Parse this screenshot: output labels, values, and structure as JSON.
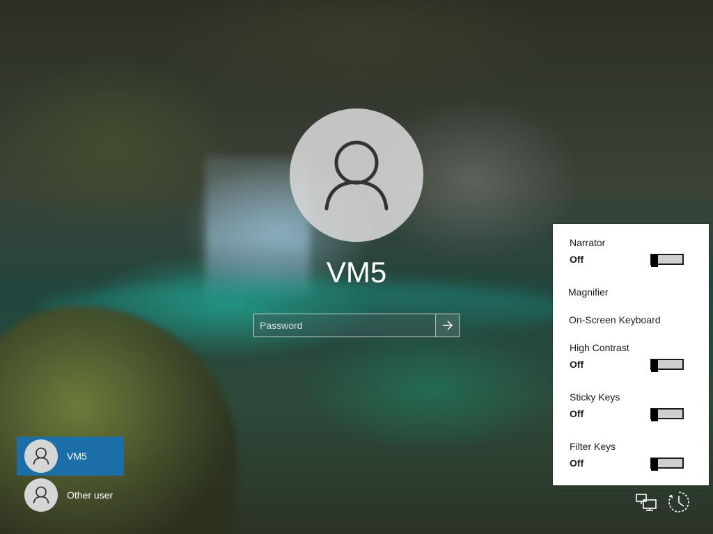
{
  "login": {
    "user_name": "VM5",
    "password_placeholder": "Password"
  },
  "users": [
    {
      "name": "VM5",
      "selected": true
    },
    {
      "name": "Other user",
      "selected": false
    }
  ],
  "ease_of_access": {
    "narrator": {
      "label": "Narrator",
      "state": "Off",
      "enabled": false
    },
    "magnifier": {
      "label": "Magnifier"
    },
    "on_screen_keyboard": {
      "label": "On-Screen Keyboard"
    },
    "high_contrast": {
      "label": "High Contrast",
      "state": "Off",
      "enabled": false
    },
    "sticky_keys": {
      "label": "Sticky Keys",
      "state": "Off",
      "enabled": false
    },
    "filter_keys": {
      "label": "Filter Keys",
      "state": "Off",
      "enabled": false
    }
  },
  "corner_icons": [
    "network-icon",
    "ease-of-access-icon"
  ],
  "colors": {
    "selected_user_bg": "#1c6ea8",
    "panel_bg": "#ffffff",
    "toggle_off_track": "#cfcfcf"
  }
}
